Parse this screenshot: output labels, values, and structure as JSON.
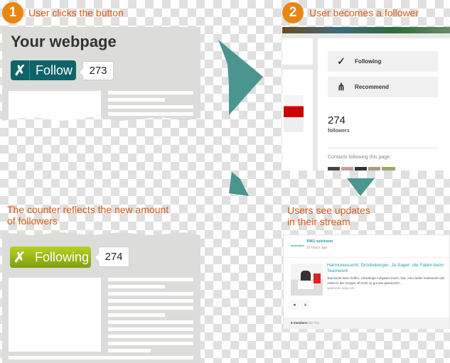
{
  "step1": {
    "number": "1",
    "label": "User clicks the button"
  },
  "step2": {
    "number": "2",
    "label": "User becomes a follower"
  },
  "step3": {
    "label_line1": "The counter reflects the new amount",
    "label_line2": "of followers"
  },
  "step4": {
    "label_line1": "Users see updates",
    "label_line2": "in their stream"
  },
  "webpage_before": {
    "title": "Your webpage",
    "button_label": "Follow",
    "count": "273",
    "button_color": "#0f6467"
  },
  "profile": {
    "following_label": "Following",
    "recommend_label": "Recommend",
    "count": "274",
    "count_label": "followers",
    "contacts_label": "Contacts following this page:"
  },
  "webpage_after": {
    "button_label": "Following",
    "count": "274",
    "button_color": "#8fb21a"
  },
  "stream": {
    "author": "XING spielraum",
    "logo_text": "spielraum",
    "time": "22 hours ago",
    "article_title": "Harmoniesucht, Drückeberger, Ja-Sager: die Fallen beim Teamwork",
    "article_desc": "Teamwork kann helfen, schwierige Aufgaben lösen, klar. Aber leider funktioniert die Arbeit in der Gruppe oft nicht so gut wie gewünscht ...",
    "article_source": "spielraum.xing.com",
    "likes_count": "5 members",
    "likes_suffix": " like this."
  },
  "colors": {
    "accent": "#e8860f",
    "caption": "#d95a16",
    "arrow": "#4a9590",
    "link": "#1fa3a0"
  },
  "icons": {
    "xing": "xing-logo-icon",
    "check": "check-icon",
    "recommend": "recommend-icon",
    "star": "star-icon",
    "share": "share-icon"
  }
}
